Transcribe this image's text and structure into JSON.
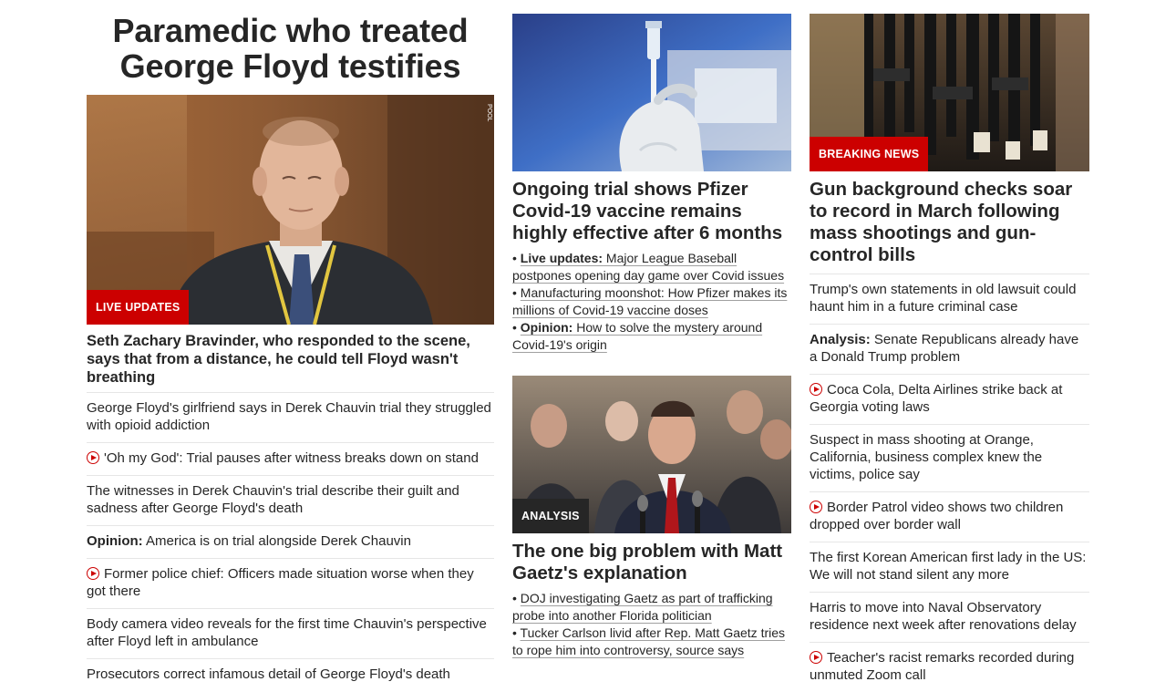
{
  "lead": {
    "title": "Paramedic who treated George Floyd testifies",
    "image": {
      "alt": "Seth Zachary Bravinder testifying",
      "watermark": "POOL",
      "badge": "LIVE UPDATES"
    },
    "subhead": "Seth Zachary Bravinder, who responded to the scene, says that from a distance, he could tell Floyd wasn't breathing",
    "links": [
      {
        "prefix": "",
        "text": "George Floyd's girlfriend says in Derek Chauvin trial they struggled with opioid addiction",
        "video": false
      },
      {
        "prefix": "",
        "text": "'Oh my God': Trial pauses after witness breaks down on stand",
        "video": true
      },
      {
        "prefix": "",
        "text": "The witnesses in Derek Chauvin's trial describe their guilt and sadness after George Floyd's death",
        "video": false
      },
      {
        "prefix": "Opinion:",
        "text": " America is on trial alongside Derek Chauvin",
        "video": false
      },
      {
        "prefix": "",
        "text": "Former police chief: Officers made situation worse when they got there",
        "video": true
      },
      {
        "prefix": "",
        "text": "Body camera video reveals for the first time Chauvin's perspective after Floyd left in ambulance",
        "video": false
      },
      {
        "prefix": "",
        "text": "Prosecutors correct infamous detail of George Floyd's death",
        "video": false
      }
    ]
  },
  "middle": {
    "story1": {
      "title": "Ongoing trial shows Pfizer Covid-19 vaccine remains highly effective after 6 months",
      "bullets": [
        {
          "prefix": "Live updates:",
          "text": " Major League Baseball postpones opening day game over Covid issues"
        },
        {
          "prefix": "",
          "text": "Manufacturing moonshot: How Pfizer makes its millions of Covid-19 vaccine doses"
        },
        {
          "prefix": "Opinion:",
          "text": " How to solve the mystery around Covid-19's origin"
        }
      ]
    },
    "story2": {
      "badge": "ANALYSIS",
      "title": "The one big problem with Matt Gaetz's explanation",
      "bullets": [
        {
          "prefix": "",
          "text": "DOJ investigating Gaetz as part of trafficking probe into another Florida politician"
        },
        {
          "prefix": "",
          "text": "Tucker Carlson livid after Rep. Matt Gaetz tries to rope him into controversy, source says"
        }
      ]
    }
  },
  "right": {
    "badge": "BREAKING NEWS",
    "title": "Gun background checks soar to record in March following mass shootings and gun-control bills",
    "links": [
      {
        "prefix": "",
        "text": "Trump's own statements in old lawsuit could haunt him in a future criminal case",
        "video": false
      },
      {
        "prefix": "Analysis:",
        "text": " Senate Republicans already have a Donald Trump problem",
        "video": false
      },
      {
        "prefix": "",
        "text": "Coca Cola, Delta Airlines strike back at Georgia voting laws",
        "video": true
      },
      {
        "prefix": "",
        "text": "Suspect in mass shooting at Orange, California, business complex knew the victims, police say",
        "video": false
      },
      {
        "prefix": "",
        "text": "Border Patrol video shows two children dropped over border wall",
        "video": true
      },
      {
        "prefix": "",
        "text": "The first Korean American first lady in the US: We will not stand silent any more",
        "video": false
      },
      {
        "prefix": "",
        "text": "Harris to move into Naval Observatory residence next week after renovations delay",
        "video": false
      },
      {
        "prefix": "",
        "text": "Teacher's racist remarks recorded during unmuted Zoom call",
        "video": true
      }
    ]
  },
  "colors": {
    "accent": "#cc0000",
    "text": "#262626",
    "divider": "#e6e6e6",
    "dark_badge": "#262626"
  }
}
